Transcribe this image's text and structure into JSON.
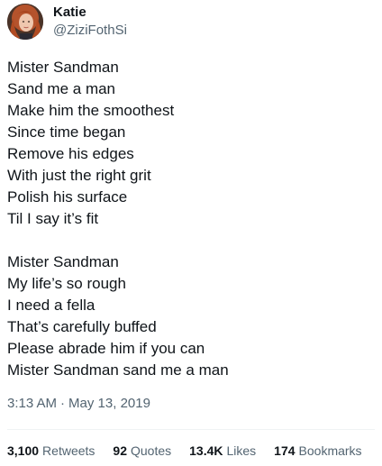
{
  "author": {
    "display_name": "Katie",
    "handle": "@ZiziFothSi"
  },
  "tweet": {
    "stanzas": [
      [
        "Mister Sandman",
        "Sand me a man",
        "Make him the smoothest",
        "Since time began",
        "Remove his edges",
        "With just the right grit",
        "Polish his surface",
        "Til I say it’s fit"
      ],
      [
        "Mister Sandman",
        "My life’s so rough",
        "I need a fella",
        "That’s carefully buffed",
        "Please abrade him if you can",
        "Mister Sandman sand me a man"
      ]
    ],
    "time": "3:13 AM",
    "separator": "·",
    "date": "May 13, 2019"
  },
  "stats": [
    {
      "value": "3,100",
      "label": "Retweets"
    },
    {
      "value": "92",
      "label": "Quotes"
    },
    {
      "value": "13.4K",
      "label": "Likes"
    },
    {
      "value": "174",
      "label": "Bookmarks"
    }
  ],
  "colors": {
    "text_primary": "#0f1419",
    "text_secondary": "#536471",
    "divider": "#eff3f4",
    "background": "#ffffff"
  }
}
